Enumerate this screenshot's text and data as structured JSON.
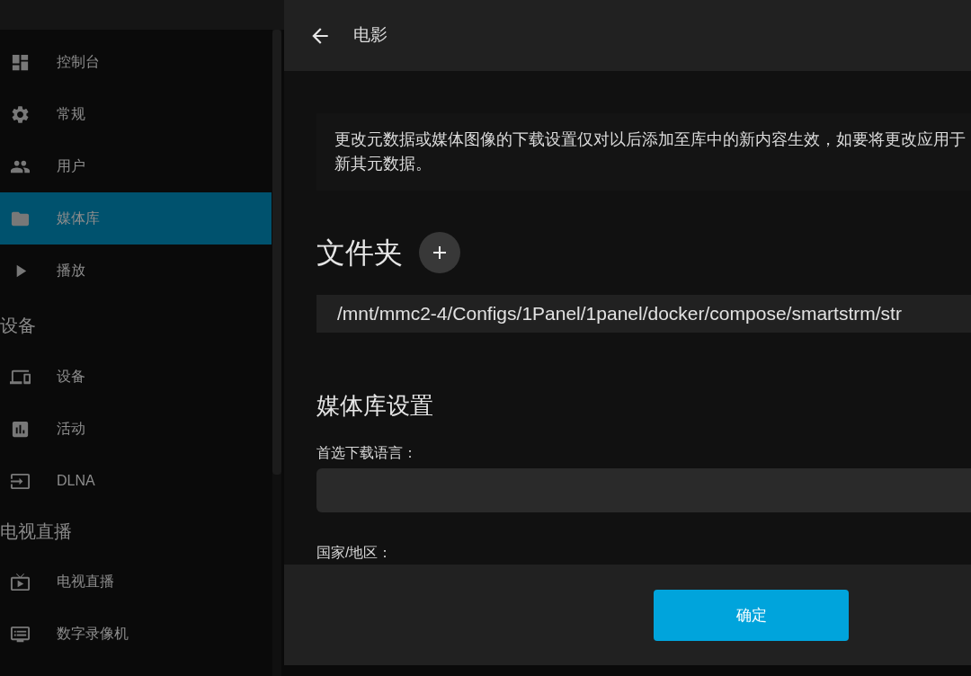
{
  "sidebar": {
    "sections": [
      {
        "items": [
          {
            "label": "控制台",
            "selected": false
          },
          {
            "label": "常规",
            "selected": false
          },
          {
            "label": "用户",
            "selected": false
          },
          {
            "label": "媒体库",
            "selected": true
          },
          {
            "label": "播放",
            "selected": false
          }
        ]
      },
      {
        "title": "设备",
        "items": [
          {
            "label": "设备",
            "selected": false
          },
          {
            "label": "活动",
            "selected": false
          },
          {
            "label": "DLNA",
            "selected": false
          }
        ]
      },
      {
        "title": "电视直播",
        "items": [
          {
            "label": "电视直播",
            "selected": false
          },
          {
            "label": "数字录像机",
            "selected": false
          }
        ]
      }
    ]
  },
  "dialog": {
    "title": "电影",
    "description_lines": [
      "更改元数据或媒体图像的下载设置仅对以后添加至库中的新内容生效，如要将更改应用于",
      "新其元数据。"
    ],
    "folders": {
      "heading": "文件夹",
      "paths": [
        "/mnt/mmc2-4/Configs/1Panel/1panel/docker/compose/smartstrm/str"
      ]
    },
    "library_settings": {
      "heading": "媒体库设置",
      "fields": [
        {
          "label": "首选下载语言：",
          "kind": "dropdown"
        },
        {
          "label": "国家/地区：",
          "kind": "label_only"
        }
      ]
    },
    "buttons": [
      "确定"
    ]
  }
}
